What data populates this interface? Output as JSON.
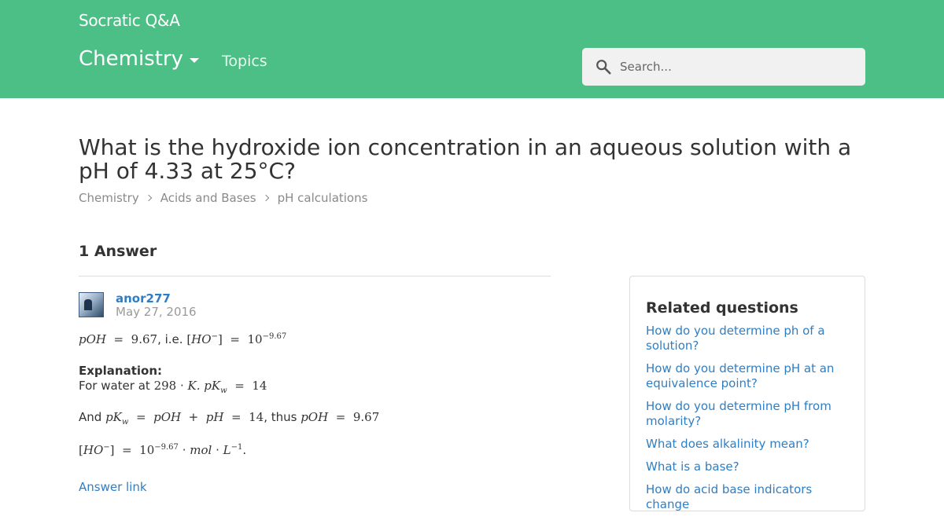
{
  "header": {
    "brand": "Socratic Q&A",
    "subject": "Chemistry",
    "topics": "Topics",
    "search_placeholder": "Search..."
  },
  "question": {
    "title": "What is the hydroxide ion concentration in an aqueous solution with a pH of 4.33 at 25°C?",
    "breadcrumbs": [
      "Chemistry",
      "Acids and Bases",
      "pH calculations"
    ]
  },
  "answers": {
    "count_label": "1 Answer",
    "author": "anor277",
    "date": "May 27, 2016",
    "summary": {
      "poh": "pOH",
      "eq": "=",
      "poh_value": "9.67",
      "ie": ", i.e. ",
      "ho": "HO",
      "ten": "10",
      "exp": "−9.67"
    },
    "explanation_label": "Explanation:",
    "water_text": "For water at ",
    "water_temp": "298",
    "water_unit": "K.",
    "pkw": "pK",
    "pkw_sub": "w",
    "pkw_value": "14",
    "and_text": "And ",
    "ph": "pH",
    "thus_text": ", thus ",
    "final_units": "mol",
    "final_L": "L",
    "final_L_exp": "−1",
    "answer_link": "Answer link"
  },
  "related": {
    "title": "Related questions",
    "items": [
      "How do you determine ph of a solution?",
      "How do you determine pH at an equivalence point?",
      "How do you determine pH from molarity?",
      "What does alkalinity mean?",
      "What is a base?",
      "How do acid base indicators change"
    ]
  },
  "colors": {
    "header_green": "#4cbf87",
    "link_blue": "#2f7ec4"
  }
}
